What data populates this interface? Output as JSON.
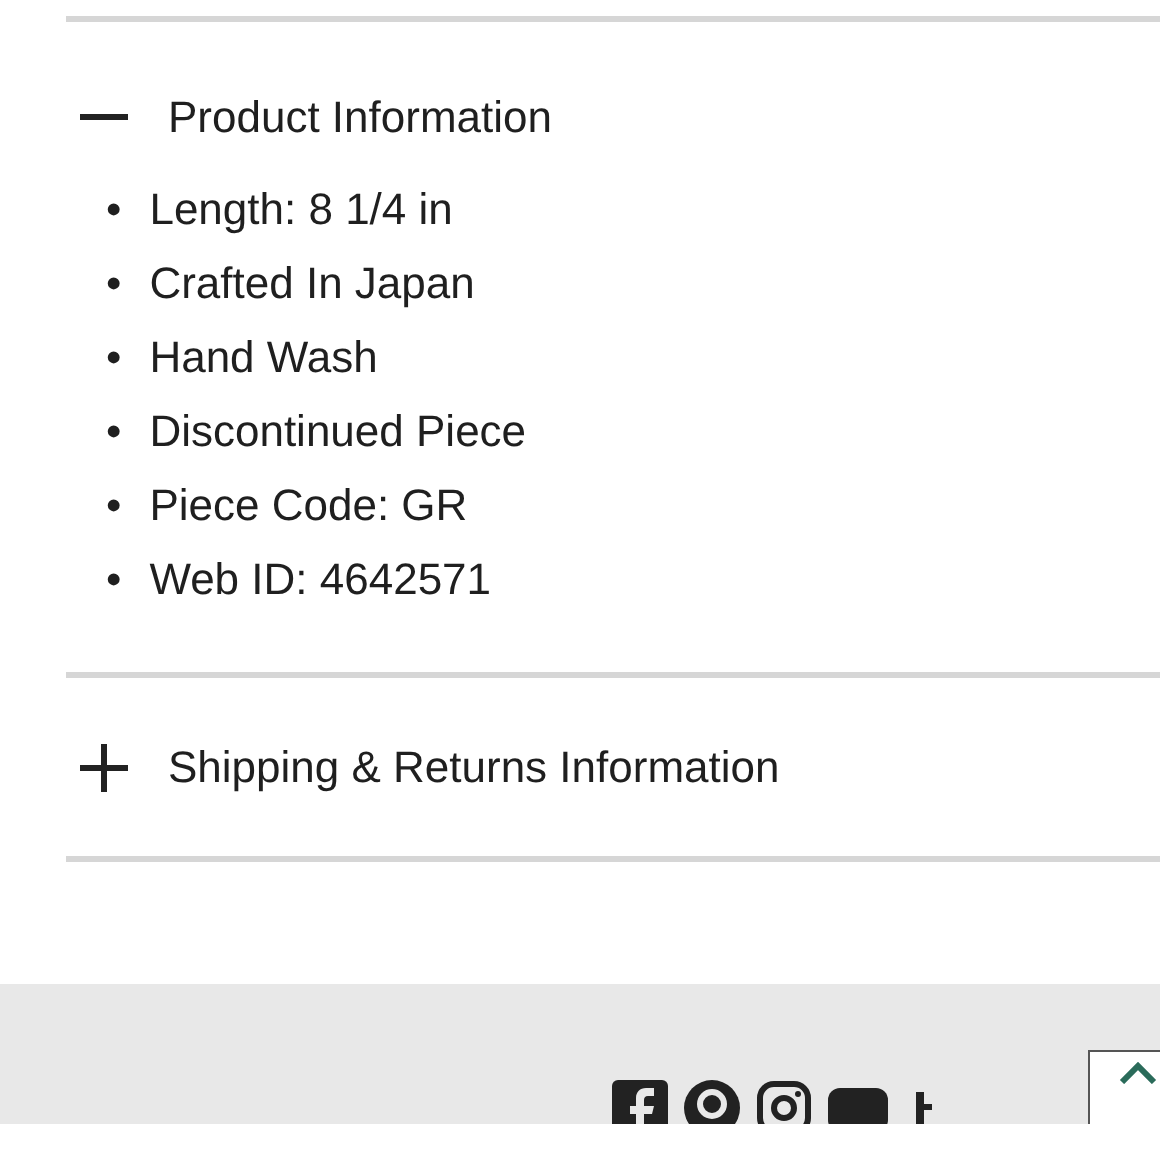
{
  "sections": [
    {
      "title": "Product Information",
      "expanded": true,
      "bullet": "•",
      "items": [
        "Length: 8 1/4 in",
        "Crafted In Japan",
        "Hand Wash",
        "Discontinued Piece",
        "Piece Code: GR",
        "Web ID: 4642571"
      ]
    },
    {
      "title": "Shipping & Returns Information",
      "expanded": false
    }
  ]
}
